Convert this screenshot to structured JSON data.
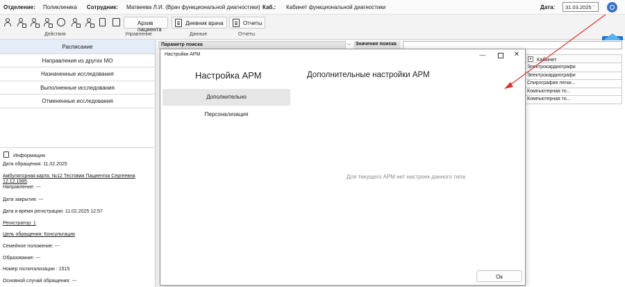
{
  "header": {
    "department_label": "Отделение:",
    "department_value": "Поликлиника",
    "employee_label": "Сотрудник:",
    "employee_value": "Матвеева Л.И. (Врач функциональной диагностики)",
    "office_label": "Каб.:",
    "office_value": "Кабинет функциональной диагностики",
    "date_label": "Дата:",
    "date_value": "31.03.2025"
  },
  "toolbar": {
    "patient_archive": "Архив пациента",
    "doctor_diary": "Дневник врача",
    "reports": "Отчеты",
    "groups": [
      "Действия",
      "Управление",
      "Данные",
      "Отчеты"
    ]
  },
  "sidebar": {
    "header": "Расписание",
    "items": [
      "Направления из других МО",
      "Назначенные исследования",
      "Выполненные исследования",
      "Отмененные исследования"
    ]
  },
  "info": {
    "title": "Информация",
    "lines": [
      "Дата обращения: 11.02.2025",
      "Амбулаторная карта: №12 Тестовая Пациентка Сергеевна",
      "12.12.1985",
      "Направление: ---",
      "Дата закрытия: ---",
      "Дата и время регистрации: 11.02.2025 12:57",
      "Регистратор: 1",
      "Цель обращения: Консультация",
      "Семейное положение: ---",
      "Образование: ---",
      "Номер госпитализации : 1515",
      "Основной случай обращения: ---"
    ]
  },
  "search": {
    "param_label": "Параметр поиска",
    "value_label": "Значение поиска"
  },
  "table": {
    "cabinet_header": "Кабинет",
    "rows": [
      "Электрокардиография",
      "Электрокардиография",
      "Спирография легки...",
      "Компьютерная то...",
      "Компьютерная то..."
    ]
  },
  "dialog": {
    "window_title": "Настройки АРМ",
    "side_title": "Настройка АРМ",
    "side_items": [
      "Дополнительно",
      "Персонализация"
    ],
    "main_title": "Дополнительные настройки АРМ",
    "empty_message": "Для текущего АРМ нет настроек данного типа",
    "ok_label": "Ок",
    "close_glyph": "✕",
    "minimize_glyph": "—"
  },
  "annotation_color": "#e0302a",
  "accent_color": "#3a6fc9"
}
